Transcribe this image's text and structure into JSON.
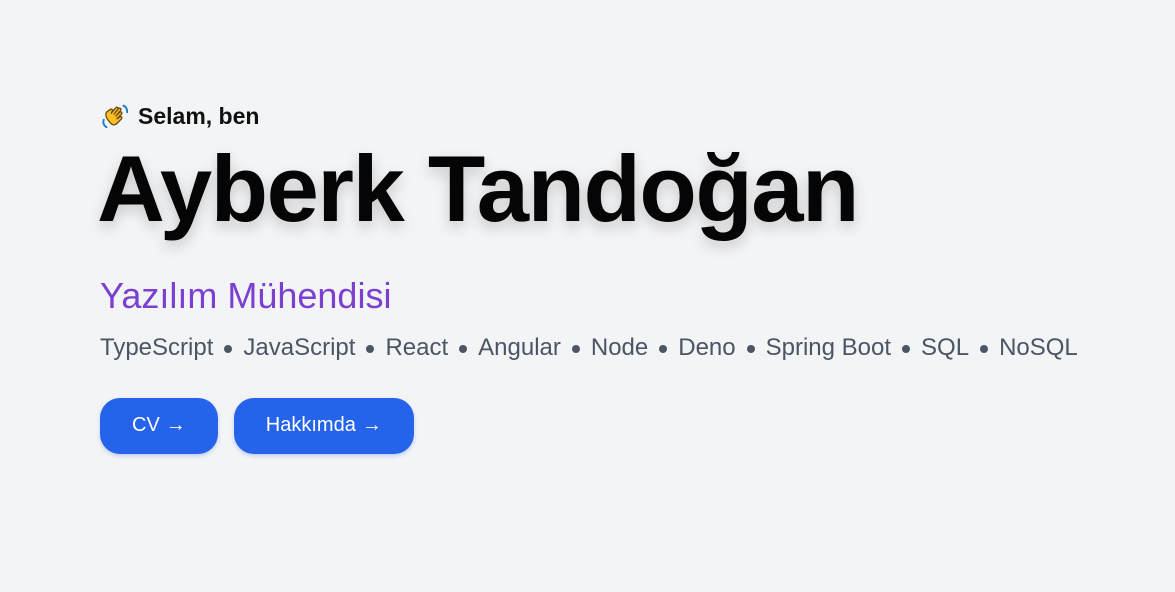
{
  "hero": {
    "greeting": "Selam, ben",
    "greeting_icon": "waving-hand-icon",
    "name": "Ayberk Tandoğan",
    "role": "Yazılım Mühendisi",
    "skills": [
      "TypeScript",
      "JavaScript",
      "React",
      "Angular",
      "Node",
      "Deno",
      "Spring Boot",
      "SQL",
      "NoSQL"
    ]
  },
  "buttons": {
    "cv_label": "CV",
    "about_label": "Hakkımda",
    "arrow": "→"
  },
  "colors": {
    "background": "#f3f4f6",
    "accent_purple": "#7b3fd1",
    "button_blue": "#2563eb",
    "text_gray": "#4b5563"
  }
}
